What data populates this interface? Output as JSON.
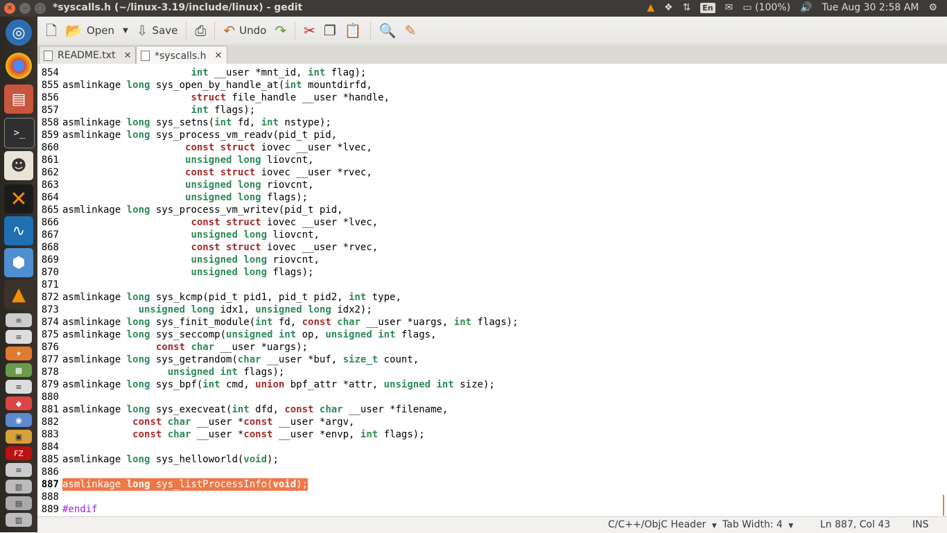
{
  "window": {
    "title": "*syscalls.h (~/linux-3.19/include/linux) - gedit"
  },
  "tray": {
    "keyboard": "En",
    "battery": "(100%)",
    "datetime": "Tue Aug 30  2:58 AM"
  },
  "toolbar": {
    "open_label": "Open",
    "save_label": "Save",
    "undo_label": "Undo"
  },
  "tabs": [
    {
      "label": "README.txt",
      "active": false
    },
    {
      "label": "*syscalls.h",
      "active": true
    }
  ],
  "editor": {
    "current_line": 887,
    "lines": [
      {
        "n": "854",
        "text": "                      int __user *mnt_id, int flag);"
      },
      {
        "n": "855",
        "text": "asmlinkage long sys_open_by_handle_at(int mountdirfd,"
      },
      {
        "n": "856",
        "text": "                      struct file_handle __user *handle,"
      },
      {
        "n": "857",
        "text": "                      int flags);"
      },
      {
        "n": "858",
        "text": "asmlinkage long sys_setns(int fd, int nstype);"
      },
      {
        "n": "859",
        "text": "asmlinkage long sys_process_vm_readv(pid_t pid,"
      },
      {
        "n": "860",
        "text": "                     const struct iovec __user *lvec,"
      },
      {
        "n": "861",
        "text": "                     unsigned long liovcnt,"
      },
      {
        "n": "862",
        "text": "                     const struct iovec __user *rvec,"
      },
      {
        "n": "863",
        "text": "                     unsigned long riovcnt,"
      },
      {
        "n": "864",
        "text": "                     unsigned long flags);"
      },
      {
        "n": "865",
        "text": "asmlinkage long sys_process_vm_writev(pid_t pid,"
      },
      {
        "n": "866",
        "text": "                      const struct iovec __user *lvec,"
      },
      {
        "n": "867",
        "text": "                      unsigned long liovcnt,"
      },
      {
        "n": "868",
        "text": "                      const struct iovec __user *rvec,"
      },
      {
        "n": "869",
        "text": "                      unsigned long riovcnt,"
      },
      {
        "n": "870",
        "text": "                      unsigned long flags);"
      },
      {
        "n": "871",
        "text": ""
      },
      {
        "n": "872",
        "text": "asmlinkage long sys_kcmp(pid_t pid1, pid_t pid2, int type,"
      },
      {
        "n": "873",
        "text": "             unsigned long idx1, unsigned long idx2);"
      },
      {
        "n": "874",
        "text": "asmlinkage long sys_finit_module(int fd, const char __user *uargs, int flags);"
      },
      {
        "n": "875",
        "text": "asmlinkage long sys_seccomp(unsigned int op, unsigned int flags,"
      },
      {
        "n": "876",
        "text": "                const char __user *uargs);"
      },
      {
        "n": "877",
        "text": "asmlinkage long sys_getrandom(char __user *buf, size_t count,"
      },
      {
        "n": "878",
        "text": "                  unsigned int flags);"
      },
      {
        "n": "879",
        "text": "asmlinkage long sys_bpf(int cmd, union bpf_attr *attr, unsigned int size);"
      },
      {
        "n": "880",
        "text": ""
      },
      {
        "n": "881",
        "text": "asmlinkage long sys_execveat(int dfd, const char __user *filename,"
      },
      {
        "n": "882",
        "text": "            const char __user *const __user *argv,"
      },
      {
        "n": "883",
        "text": "            const char __user *const __user *envp, int flags);"
      },
      {
        "n": "884",
        "text": ""
      },
      {
        "n": "885",
        "text": "asmlinkage long sys_helloworld(void);"
      },
      {
        "n": "886",
        "text": ""
      },
      {
        "n": "887",
        "text": "asmlinkage long sys_listProcessInfo(void);"
      },
      {
        "n": "888",
        "text": ""
      },
      {
        "n": "889",
        "text": "#endif"
      }
    ]
  },
  "statusbar": {
    "language": "C/C++/ObjC Header",
    "tab_width": "Tab Width: 4",
    "position": "Ln 887, Col 43",
    "mode": "INS"
  },
  "colors": {
    "selection": "#f07746",
    "type": "#2e8b57",
    "keyword": "#a52a2a",
    "preprocessor": "#a020f0"
  }
}
